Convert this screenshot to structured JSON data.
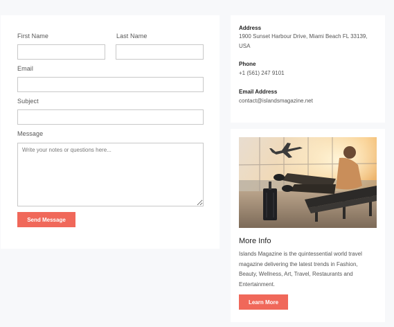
{
  "form": {
    "first_name_label": "First Name",
    "first_name_value": "",
    "last_name_label": "Last Name",
    "last_name_value": "",
    "email_label": "Email",
    "email_value": "",
    "subject_label": "Subject",
    "subject_value": "",
    "message_label": "Message",
    "message_placeholder": "Write your notes or questions here...",
    "send_button": "Send Message"
  },
  "contact": {
    "address_heading": "Address",
    "address_text": "1900 Sunset Harbour Drive, Miami Beach FL 33139, USA",
    "phone_heading": "Phone",
    "phone_text": "+1 (561) 247 9101",
    "email_heading": "Email Address",
    "email_text": "contact@islandsmagazine.net"
  },
  "more_info": {
    "image_icon": "airport-traveler-photo",
    "title": "More Info",
    "description": "Islands Magazine is the quintessential world travel magazine delivering the latest trends in Fashion, Beauty, Wellness, Art, Travel, Restaurants and Entertainment.",
    "button": "Learn More"
  },
  "colors": {
    "accent": "#f0685a",
    "background": "#f7f8fa",
    "card": "#ffffff"
  }
}
